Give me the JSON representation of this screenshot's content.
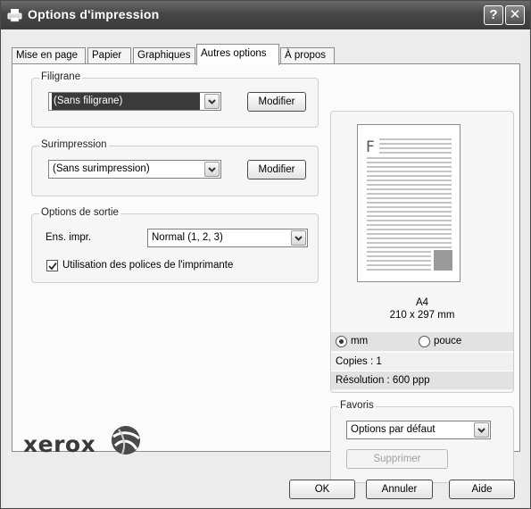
{
  "window": {
    "title": "Options d'impression",
    "help_label": "?",
    "close_label": "✕"
  },
  "tabs": [
    {
      "label": "Mise en page",
      "active": false
    },
    {
      "label": "Papier",
      "active": false
    },
    {
      "label": "Graphiques",
      "active": false
    },
    {
      "label": "Autres options",
      "active": true
    },
    {
      "label": "À propos",
      "active": false
    }
  ],
  "filigrane": {
    "legend": "Filigrane",
    "value": "(Sans filigrane)",
    "modify_label": "Modifier"
  },
  "surimpression": {
    "legend": "Surimpression",
    "value": "(Sans surimpression)",
    "modify_label": "Modifier"
  },
  "sortie": {
    "legend": "Options de sortie",
    "ens_label": "Ens. impr.",
    "ens_value": "Normal (1, 2, 3)",
    "fonts_label": "Utilisation des polices de l'imprimante",
    "fonts_checked": true
  },
  "preview": {
    "page_letter": "F",
    "paper_name": "A4",
    "paper_size": "210 x 297 mm",
    "unit_mm": "mm",
    "unit_pouce": "pouce",
    "unit_selected": "mm",
    "copies": "Copies : 1",
    "resolution": "Résolution : 600 ppp"
  },
  "favoris": {
    "legend": "Favoris",
    "value": "Options par défaut",
    "delete_label": "Supprimer"
  },
  "brand": {
    "name": "xerox"
  },
  "footer": {
    "ok_label": "OK",
    "cancel_label": "Annuler",
    "help_label": "Aide"
  },
  "colors": {
    "titlebar": "#464646",
    "selection": "#3a3a3a",
    "preview_block": "#9a9a9a"
  }
}
